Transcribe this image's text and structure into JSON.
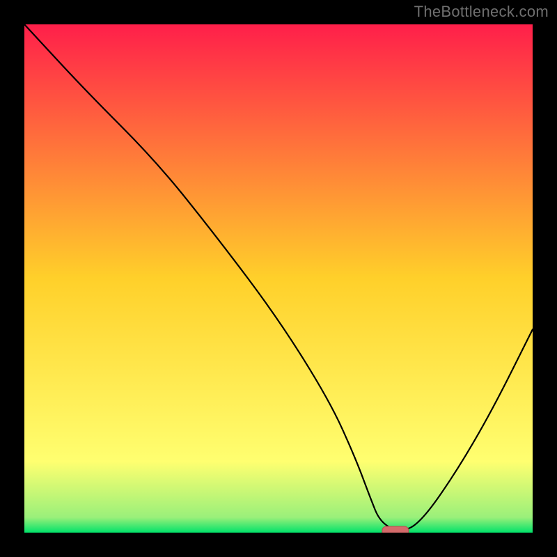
{
  "watermark": "TheBottleneck.com",
  "colors": {
    "bg": "#000000",
    "gradient_top": "#ff1f4a",
    "gradient_mid": "#ffd02a",
    "gradient_low_yellow": "#ffff70",
    "gradient_green": "#00e26a",
    "curve": "#000000",
    "marker_fill": "#d46a6a",
    "marker_stroke": "#b94f4f"
  },
  "chart_data": {
    "type": "line",
    "title": "",
    "xlabel": "",
    "ylabel": "",
    "xlim": [
      0,
      100
    ],
    "ylim": [
      0,
      100
    ],
    "series": [
      {
        "name": "bottleneck-curve",
        "x": [
          0,
          12,
          26,
          38,
          50,
          60,
          65,
          68,
          70,
          74,
          78,
          85,
          92,
          100
        ],
        "values": [
          100,
          87,
          73,
          58,
          42,
          26,
          15,
          7,
          2,
          0,
          2,
          12,
          24,
          40
        ]
      }
    ],
    "annotations": [
      {
        "name": "optimal-marker",
        "x": 73,
        "y": 0
      }
    ],
    "legend": false,
    "grid": false
  }
}
